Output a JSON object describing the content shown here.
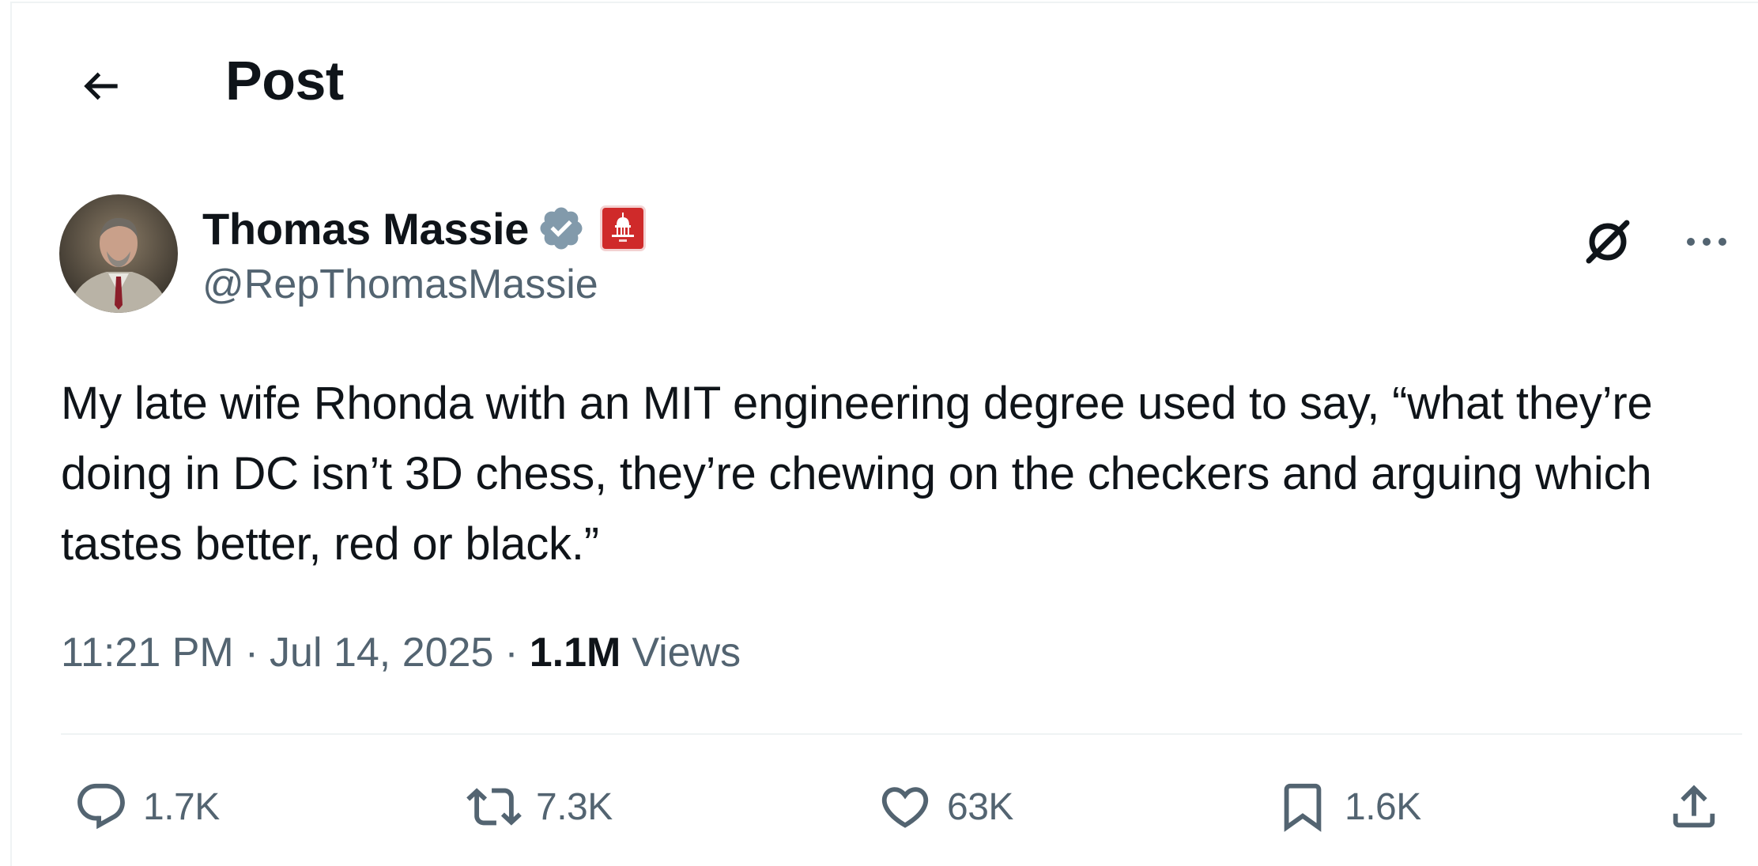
{
  "header": {
    "title": "Post",
    "back_icon": "arrow-left-icon"
  },
  "author": {
    "display_name": "Thomas Massie",
    "handle": "@RepThomasMassie",
    "verified_icon": "verified-badge-icon",
    "affiliation_icon": "capitol-building-icon",
    "colors": {
      "verified": "#829aab",
      "affiliation": "#cf2a2a"
    }
  },
  "post": {
    "text": "My late wife Rhonda with an MIT engineering degree used to say, “what they’re doing in DC isn’t 3D chess, they’re chewing on the checkers and arguing which tastes better, red or black.”",
    "time": "11:21 PM",
    "date": "Jul 14, 2025",
    "separator": "·",
    "views_count": "1.1M",
    "views_label": "Views"
  },
  "actions": {
    "replies": "1.7K",
    "reposts": "7.3K",
    "likes": "63K",
    "bookmarks": "1.6K"
  },
  "colors": {
    "text": "#0f1419",
    "secondary": "#536471",
    "divider": "#eff3f4"
  }
}
